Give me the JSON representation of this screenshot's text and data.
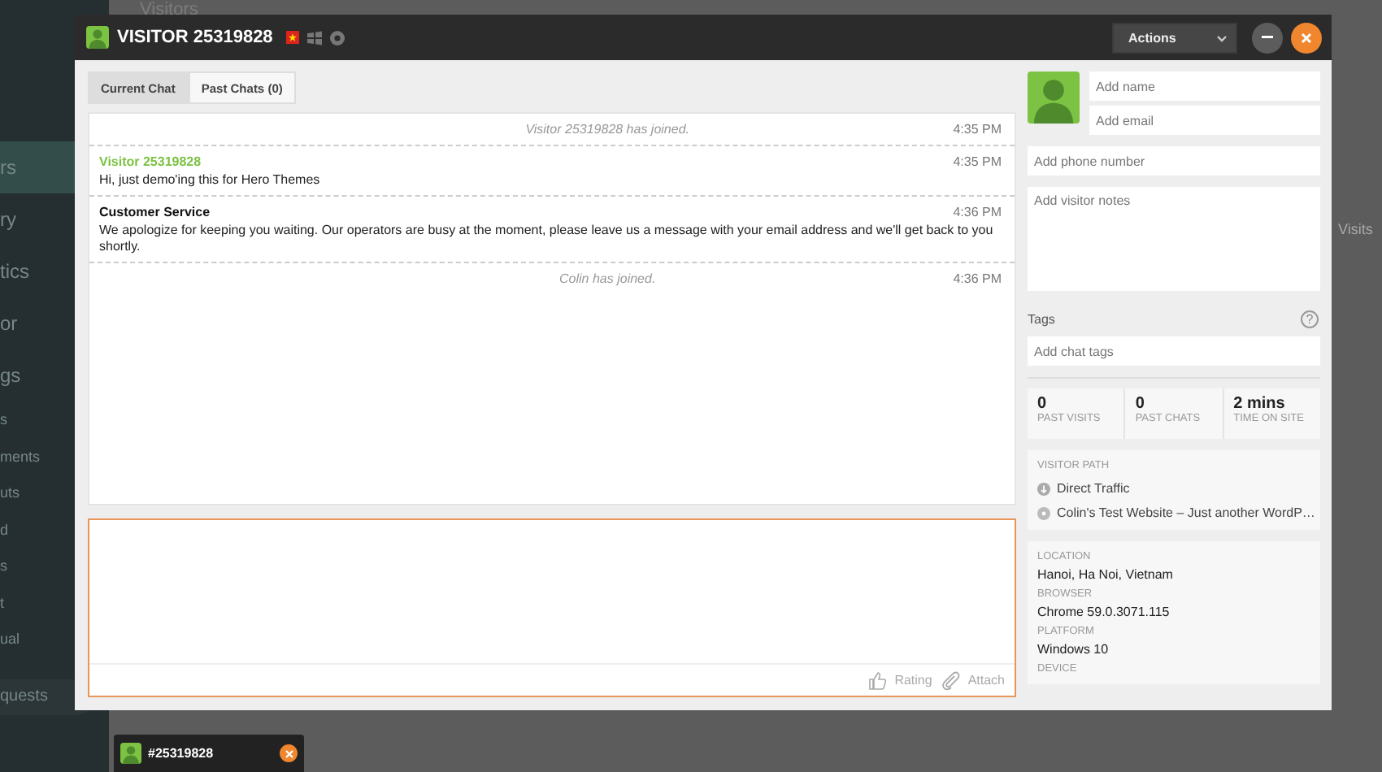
{
  "background": {
    "header": "Visitors",
    "column_header": "Visits",
    "sidebar_items": [
      {
        "label": "rs",
        "kind": "main",
        "selected": true
      },
      {
        "label": "ry",
        "kind": "main",
        "selected": false
      },
      {
        "label": "tics",
        "kind": "main",
        "selected": false
      },
      {
        "label": "or",
        "kind": "main",
        "selected": false
      },
      {
        "label": "gs",
        "kind": "main",
        "selected": false
      },
      {
        "label": "s",
        "kind": "sub",
        "selected": false
      },
      {
        "label": "ments",
        "kind": "sub",
        "selected": false
      },
      {
        "label": "uts",
        "kind": "sub",
        "selected": false
      },
      {
        "label": "d",
        "kind": "sub",
        "selected": false
      },
      {
        "label": "s",
        "kind": "sub",
        "selected": false
      },
      {
        "label": "t",
        "kind": "sub",
        "selected": false
      },
      {
        "label": "ual",
        "kind": "sub",
        "selected": false
      },
      {
        "label": "quests",
        "kind": "pill",
        "selected": false
      }
    ]
  },
  "chat_window": {
    "title": "VISITOR 25319828",
    "actions": "Actions",
    "tabs": [
      {
        "label": "Current Chat",
        "selected": true
      },
      {
        "label": "Past Chats (0)",
        "selected": false
      }
    ],
    "messages": [
      {
        "kind": "event",
        "text": "Visitor 25319828 has joined.",
        "time": "4:35 PM"
      },
      {
        "kind": "visitor",
        "author": "Visitor 25319828",
        "text": "Hi, just demo'ing this for Hero Themes",
        "time": "4:35 PM"
      },
      {
        "kind": "agent",
        "author": "Customer Service",
        "text": "We apologize for keeping you waiting. Our operators are busy at the moment, please leave us a message with your email address and we'll get back to you shortly.",
        "time": "4:36 PM"
      },
      {
        "kind": "event",
        "text": "Colin has joined.",
        "time": "4:36 PM"
      }
    ],
    "composer": {
      "rating": "Rating",
      "attach": "Attach"
    },
    "visitor": {
      "name_placeholder": "Add name",
      "email_placeholder": "Add email",
      "phone_placeholder": "Add phone number",
      "notes_placeholder": "Add visitor notes",
      "tags_label": "Tags",
      "help": "?",
      "tags_placeholder": "Add chat tags",
      "stats": [
        {
          "value": "0",
          "label": "PAST VISITS"
        },
        {
          "value": "0",
          "label": "PAST CHATS"
        },
        {
          "value": "2 mins",
          "label": "TIME ON SITE"
        }
      ],
      "path_heading": "VISITOR PATH",
      "path": [
        {
          "kind": "referrer",
          "text": "Direct Traffic"
        },
        {
          "kind": "page",
          "text": "Colin's Test Website – Just another WordP…"
        }
      ],
      "details": [
        {
          "label": "LOCATION",
          "value": "Hanoi, Ha Noi, Vietnam"
        },
        {
          "label": "BROWSER",
          "value": "Chrome 59.0.3071.115"
        },
        {
          "label": "PLATFORM",
          "value": "Windows 10"
        },
        {
          "label": "DEVICE"
        }
      ]
    }
  },
  "taskbar": {
    "label": "#25319828"
  }
}
